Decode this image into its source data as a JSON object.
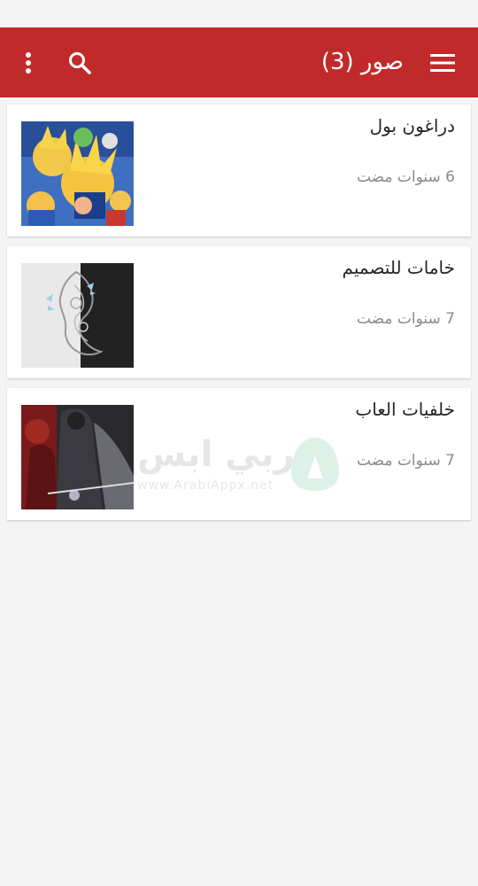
{
  "app_bar": {
    "title": "صور (3)",
    "menu_icon": "hamburger-menu-icon",
    "search_icon": "search-icon",
    "more_icon": "more-vert-icon",
    "color": "#c12a2a"
  },
  "albums": [
    {
      "title": "دراغون بول",
      "time": "6 سنوات مضت",
      "thumb": "dragon-ball-art"
    },
    {
      "title": "خامات للتصميم",
      "time": "7 سنوات مضت",
      "thumb": "paisley-pattern-art"
    },
    {
      "title": "خلفيات العاب",
      "time": "7 سنوات مضت",
      "thumb": "game-warrior-art"
    }
  ],
  "watermark": {
    "text": "عربي ابس",
    "url": "www.ArabiAppx.net"
  }
}
